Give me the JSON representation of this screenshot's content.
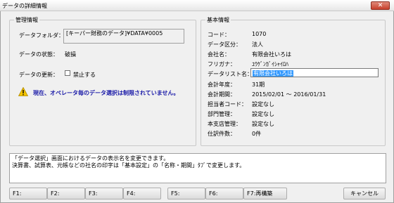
{
  "window": {
    "title": "データの詳細情報",
    "close_label": "✕"
  },
  "left": {
    "group_title": "管理情報",
    "folder_label": "データフォルダ：",
    "folder_value": "[キーパー財務のデータ]¥DATA¥0005",
    "status_label": "データの状態：",
    "status_value": "破損",
    "update_label": "データの更新：",
    "update_checkbox_label": "禁止する",
    "update_checked": false,
    "warning_icon": "warning-icon",
    "warning_text": "現在、オペレータ毎のデータ選択は制限されていません。"
  },
  "right": {
    "group_title": "基本情報",
    "rows": [
      {
        "label": "コード：",
        "value": "1070"
      },
      {
        "label": "データ区分：",
        "value": "法人"
      },
      {
        "label": "会社名：",
        "value": "有限会社いろは"
      },
      {
        "label": "フリガナ：",
        "value": "ﾕｳｹﾞﾝｶﾞｲｼｬｲﾛﾊ"
      },
      {
        "label": "データリスト名：",
        "value": "有限会社いろは"
      },
      {
        "label": "会計年度：",
        "value": "31期"
      },
      {
        "label": "会計期間：",
        "value": "2015/02/01 ～ 2016/01/31"
      },
      {
        "label": "担当者コード：",
        "value": "設定なし"
      },
      {
        "label": "部門管理：",
        "value": "設定なし"
      },
      {
        "label": "本支店管理：",
        "value": "設定なし"
      },
      {
        "label": "仕訳件数：",
        "value": "0件"
      }
    ]
  },
  "message": {
    "line1": "「データ選択」画面におけるデータの表示名を変更できます。",
    "line2": "決算書、試算表、元帳などの社名の印字は「基本設定」の「名称・期間」ﾀﾌﾞで変更します。"
  },
  "function_keys": [
    "F1:",
    "F2:",
    "F3:",
    "F4:",
    "F5:",
    "F6:",
    "F7:再構築"
  ],
  "cancel_label": "キャンセル"
}
